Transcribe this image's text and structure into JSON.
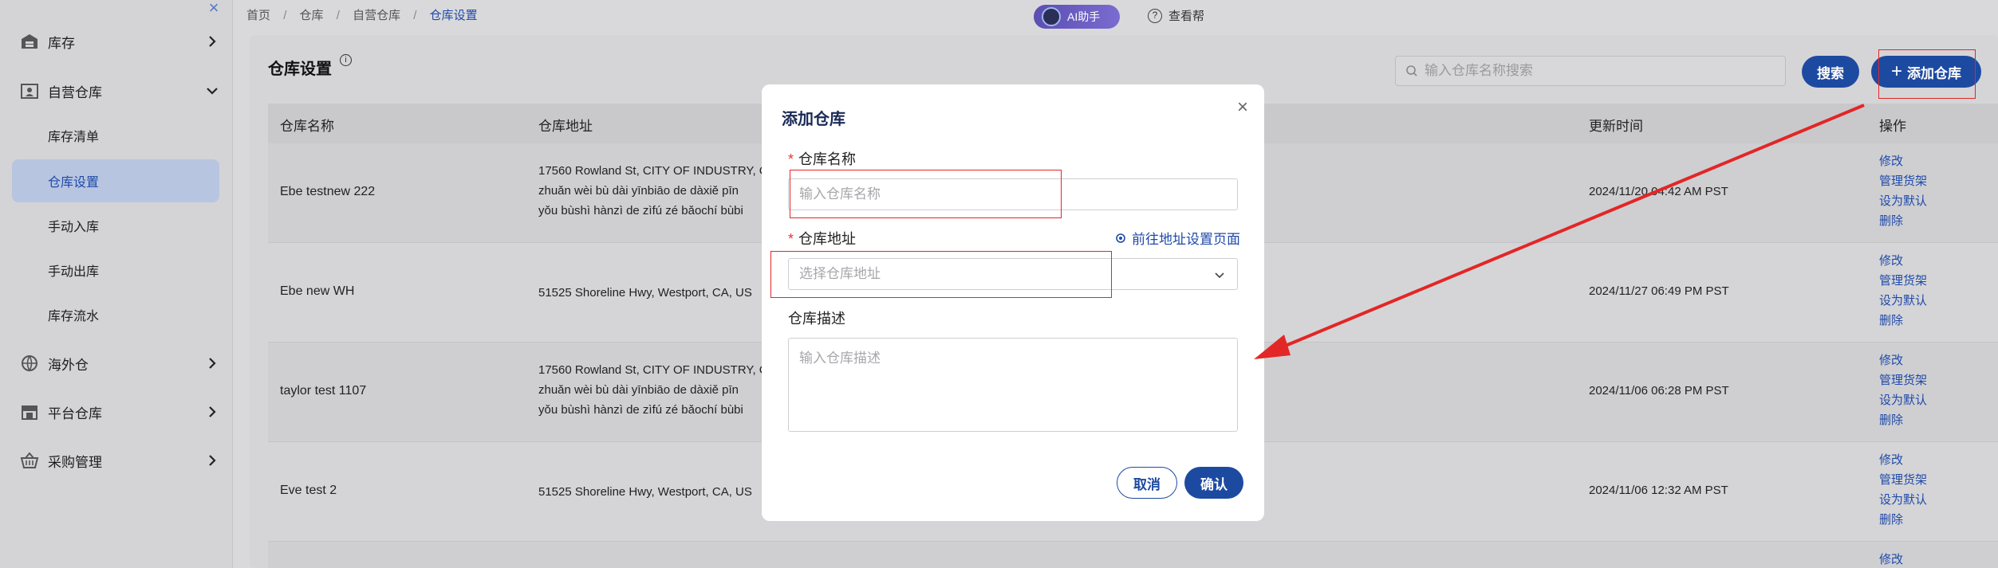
{
  "sidebar": {
    "items": [
      {
        "label": "库存",
        "icon": "warehouse-icon"
      },
      {
        "label": "自营仓库",
        "icon": "self-warehouse-icon"
      },
      {
        "label": "海外仓",
        "icon": "globe-icon"
      },
      {
        "label": "平台仓库",
        "icon": "store-icon"
      },
      {
        "label": "采购管理",
        "icon": "basket-icon"
      }
    ],
    "subitems": [
      "库存清单",
      "仓库设置",
      "手动入库",
      "手动出库",
      "库存流水"
    ]
  },
  "header": {
    "breadcrumbs": [
      "首页",
      "仓库",
      "自营仓库",
      "仓库设置"
    ],
    "separator": "/",
    "ai_label": "AI助手",
    "help_label": "查看帮"
  },
  "main": {
    "title": "仓库设置",
    "search_placeholder": "输入仓库名称搜索",
    "search_button": "搜索",
    "add_button": "添加仓库",
    "columns": {
      "name": "仓库名称",
      "address": "仓库地址",
      "updated": "更新时间",
      "actions": "操作"
    },
    "actions": [
      "修改",
      "管理货架",
      "设为默认",
      "删除"
    ],
    "rows": [
      {
        "name": "Ebe testnew 222",
        "address_lines": [
          "17560 Rowland St, CITY OF INDUSTRY, C",
          "zhuǎn wèi bù dài yīnbiāo de dàxiě pīn",
          "yǒu bùshì hànzì de zìfú zé bǎochí bùbi"
        ],
        "updated": "2024/11/20 04:42 AM PST"
      },
      {
        "name": "Ebe new WH",
        "address_lines": [
          "51525 Shoreline Hwy, Westport, CA, US"
        ],
        "updated": "2024/11/27 06:49 PM PST"
      },
      {
        "name": "taylor test 1107",
        "address_lines": [
          "17560 Rowland St, CITY OF INDUSTRY, C",
          "zhuǎn wèi bù dài yīnbiāo de dàxiě pīn",
          "yǒu bùshì hànzì de zìfú zé bǎochí bùbi"
        ],
        "updated": "2024/11/06 06:28 PM PST"
      },
      {
        "name": "Eve test 2",
        "address_lines": [
          "51525 Shoreline Hwy, Westport, CA, US"
        ],
        "updated": "2024/11/06 12:32 AM PST"
      }
    ],
    "partial_row_action": "修改"
  },
  "modal": {
    "title": "添加仓库",
    "name_label": "仓库名称",
    "name_placeholder": "输入仓库名称",
    "address_label": "仓库地址",
    "address_placeholder": "选择仓库地址",
    "address_link": "前往地址设置页面",
    "desc_label": "仓库描述",
    "desc_placeholder": "输入仓库描述",
    "cancel": "取消",
    "confirm": "确认",
    "required_mark": "*"
  },
  "colors": {
    "primary": "#1d4aa1",
    "link": "#1f4aa8",
    "annotation_red": "#e32626",
    "required": "#e03838"
  }
}
